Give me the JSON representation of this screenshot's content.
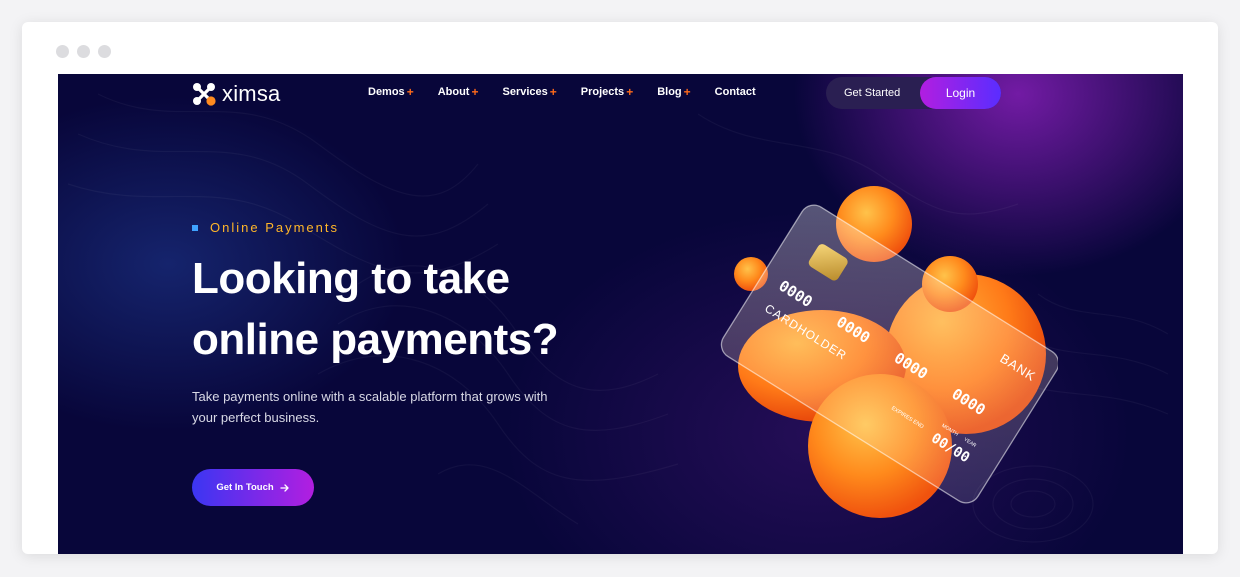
{
  "header": {
    "logo": "ximsa",
    "nav": [
      {
        "label": "Demos",
        "has_submenu": true
      },
      {
        "label": "About",
        "has_submenu": true
      },
      {
        "label": "Services",
        "has_submenu": true
      },
      {
        "label": "Projects",
        "has_submenu": true
      },
      {
        "label": "Blog",
        "has_submenu": true
      },
      {
        "label": "Contact",
        "has_submenu": false
      }
    ],
    "submenu_marker": "+",
    "get_started": "Get Started",
    "login": "Login"
  },
  "hero": {
    "eyebrow": "Online Payments",
    "headline_line1": "Looking to take",
    "headline_line2": "online payments?",
    "subtext_line1": "Take payments online with a scalable platform that grows with",
    "subtext_line2": "your perfect business.",
    "cta": "Get In Touch",
    "cta_icon": "arrow-right-icon"
  },
  "card": {
    "number_groups": [
      "0000",
      "0000",
      "0000",
      "0000"
    ],
    "holder": "CARDHOLDER",
    "bank": "BANK",
    "expiry": "00/00",
    "expires_label": "EXPIRES END",
    "month_label": "MONTH",
    "year_label": "YEAR"
  },
  "colors": {
    "background": "#08063a",
    "accent_orange": "#ff6a1a",
    "eyebrow": "#ffb629",
    "login_gradient": [
      "#b21ee0",
      "#5a2dff"
    ],
    "cta_gradient": [
      "#3b36f2",
      "#b21ee0"
    ]
  }
}
